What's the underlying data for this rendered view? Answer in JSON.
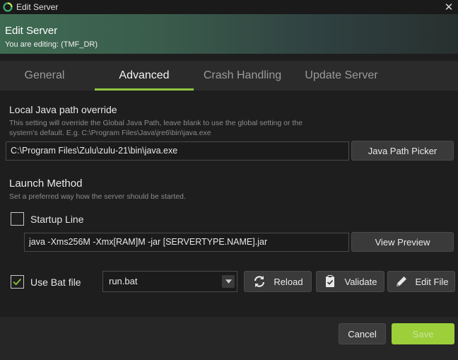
{
  "window": {
    "title": "Edit Server",
    "close_glyph": "✕"
  },
  "header": {
    "title": "Edit Server",
    "subtitle": "You are editing: (TMF_DR)"
  },
  "tabs": [
    {
      "label": "General",
      "active": false
    },
    {
      "label": "Advanced",
      "active": true
    },
    {
      "label": "Crash Handling",
      "active": false
    },
    {
      "label": "Update Server",
      "active": false
    }
  ],
  "java_path": {
    "title": "Local Java path override",
    "desc_line1": "This setting will override the Global Java Path, leave blank to use the global setting or the",
    "desc_line2": "system's default.  E.g. C:\\Program Files\\Java\\jre6\\bin\\java.exe",
    "value": "C:\\Program Files\\Zulu\\zulu-21\\bin\\java.exe",
    "picker_label": "Java Path Picker"
  },
  "launch": {
    "title": "Launch Method",
    "desc": "Set a preferred way how the server should be started.",
    "startup_label": "Startup Line",
    "startup_checked": false,
    "startup_value": "java -Xms256M -Xmx[RAM]M -jar [SERVERTYPE.NAME].jar",
    "preview_label": "View Preview",
    "bat_label": "Use Bat file",
    "bat_checked": true,
    "bat_value": "run.bat",
    "reload_label": "Reload",
    "validate_label": "Validate",
    "edit_label": "Edit File"
  },
  "footer": {
    "cancel_label": "Cancel",
    "save_label": "Save"
  },
  "colors": {
    "accent": "#8dc63f",
    "save_bg": "#9ccf3a",
    "background": "#1e1e1e"
  },
  "icons": [
    "app-logo-icon",
    "close-icon",
    "reload-icon",
    "clipboard-check-icon",
    "pencil-icon",
    "chevron-down-icon",
    "checkmark-icon"
  ]
}
